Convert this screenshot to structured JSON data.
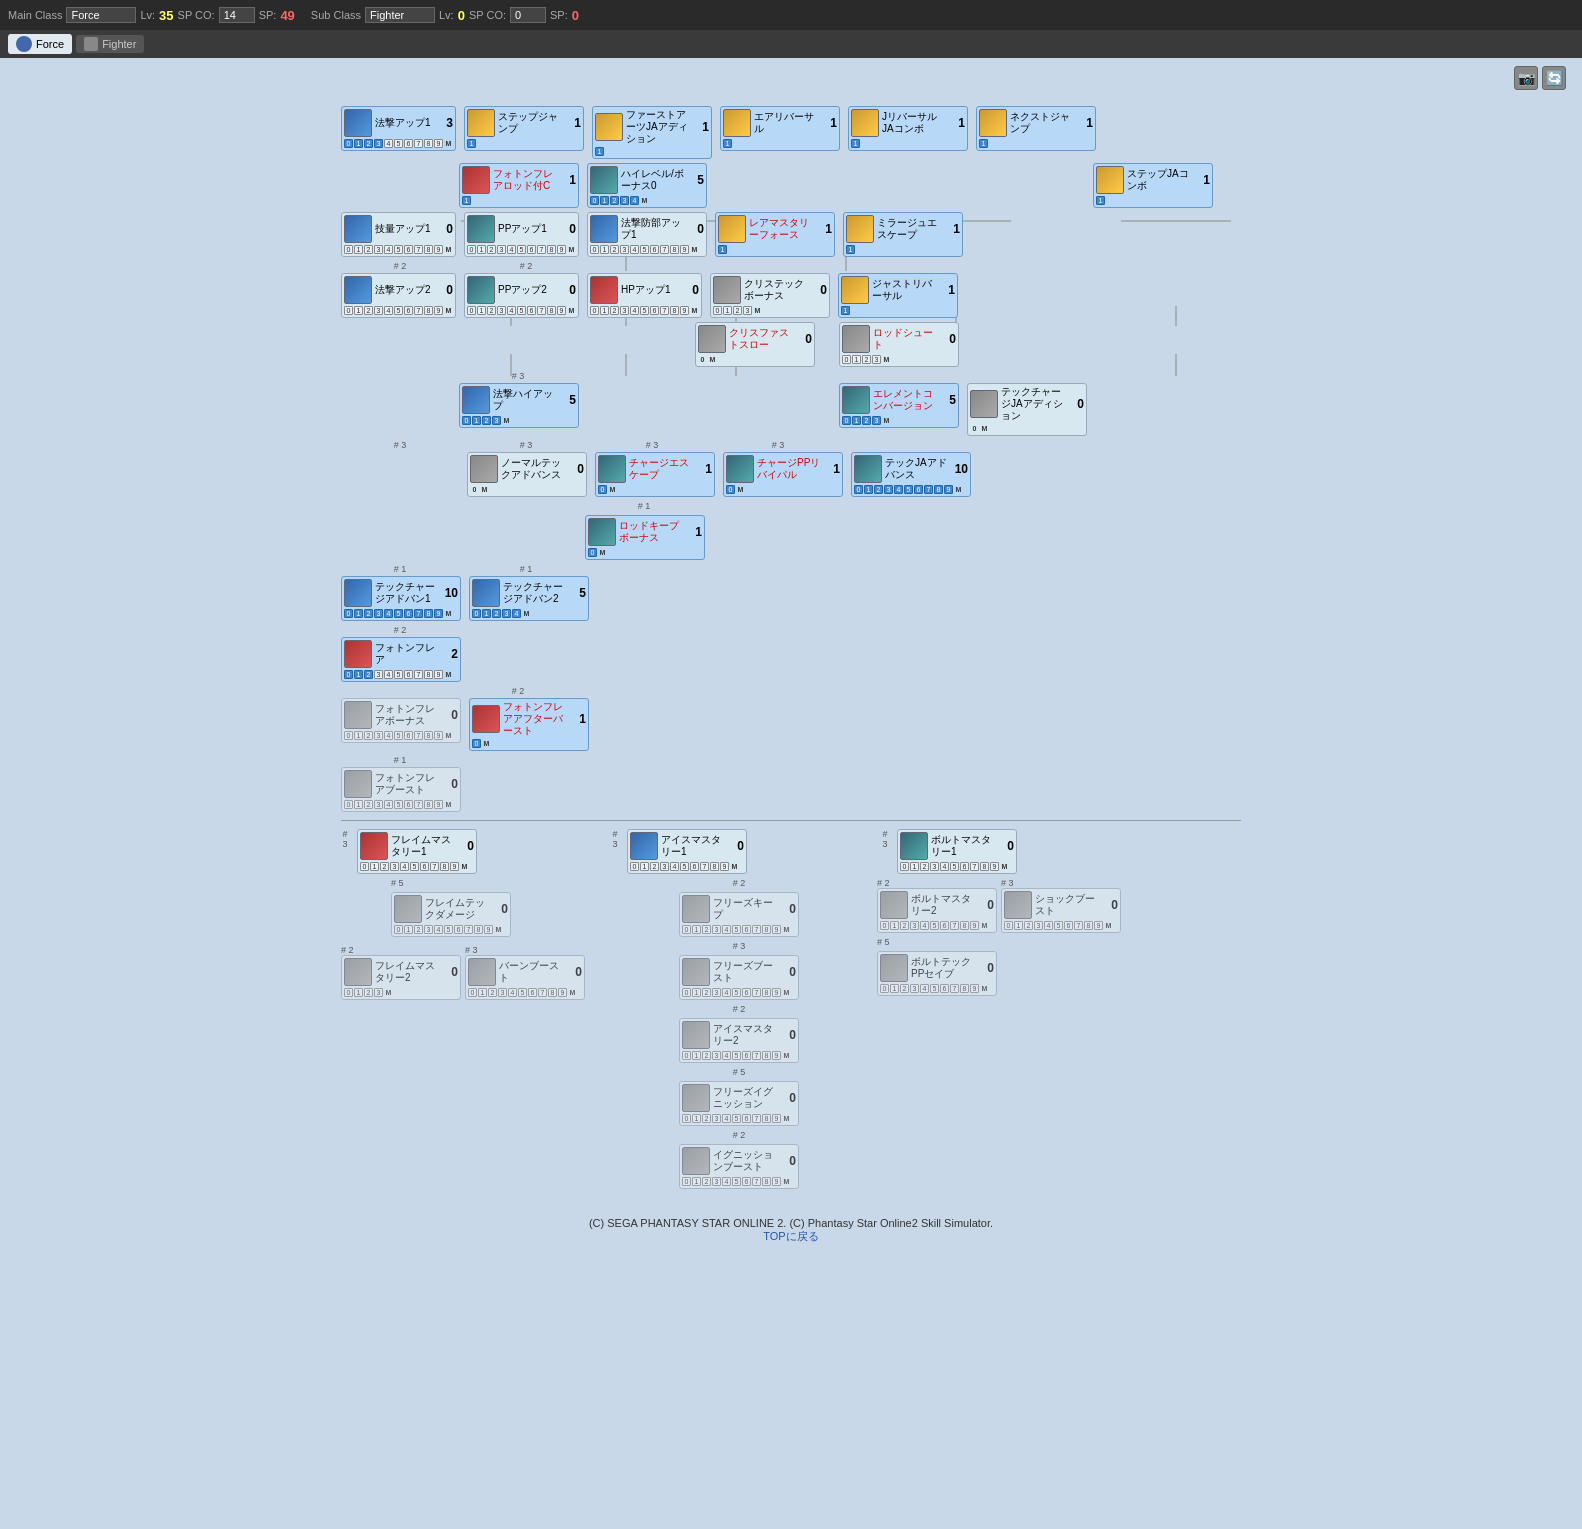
{
  "header": {
    "main_class_label": "Main Class",
    "main_class_value": "Force",
    "main_lv_label": "Lv:",
    "main_lv_value": "35",
    "main_sp_co_label": "SP CO:",
    "main_sp_co_value": "14",
    "main_sp_label": "SP:",
    "main_sp_value": "49",
    "sub_class_label": "Sub Class",
    "sub_class_value": "Fighter",
    "sub_lv_label": "Lv:",
    "sub_lv_value": "0",
    "sub_sp_co_label": "SP CO:",
    "sub_sp_co_value": "0",
    "sub_sp_label": "SP:",
    "sub_sp_value": "0"
  },
  "tabs": [
    {
      "id": "force",
      "label": "Force",
      "active": true
    },
    {
      "id": "fighter",
      "label": "Fighter",
      "active": false
    }
  ],
  "toolbar": {
    "camera_icon": "📷",
    "refresh_icon": "🔄"
  },
  "footer": {
    "copy_text": "(C) SEGA PHANTASY STAR ONLINE 2.",
    "copy_text2": "(C) Phantasy Star Online2 Skill Simulator.",
    "top_link": "TOPに戻る"
  }
}
